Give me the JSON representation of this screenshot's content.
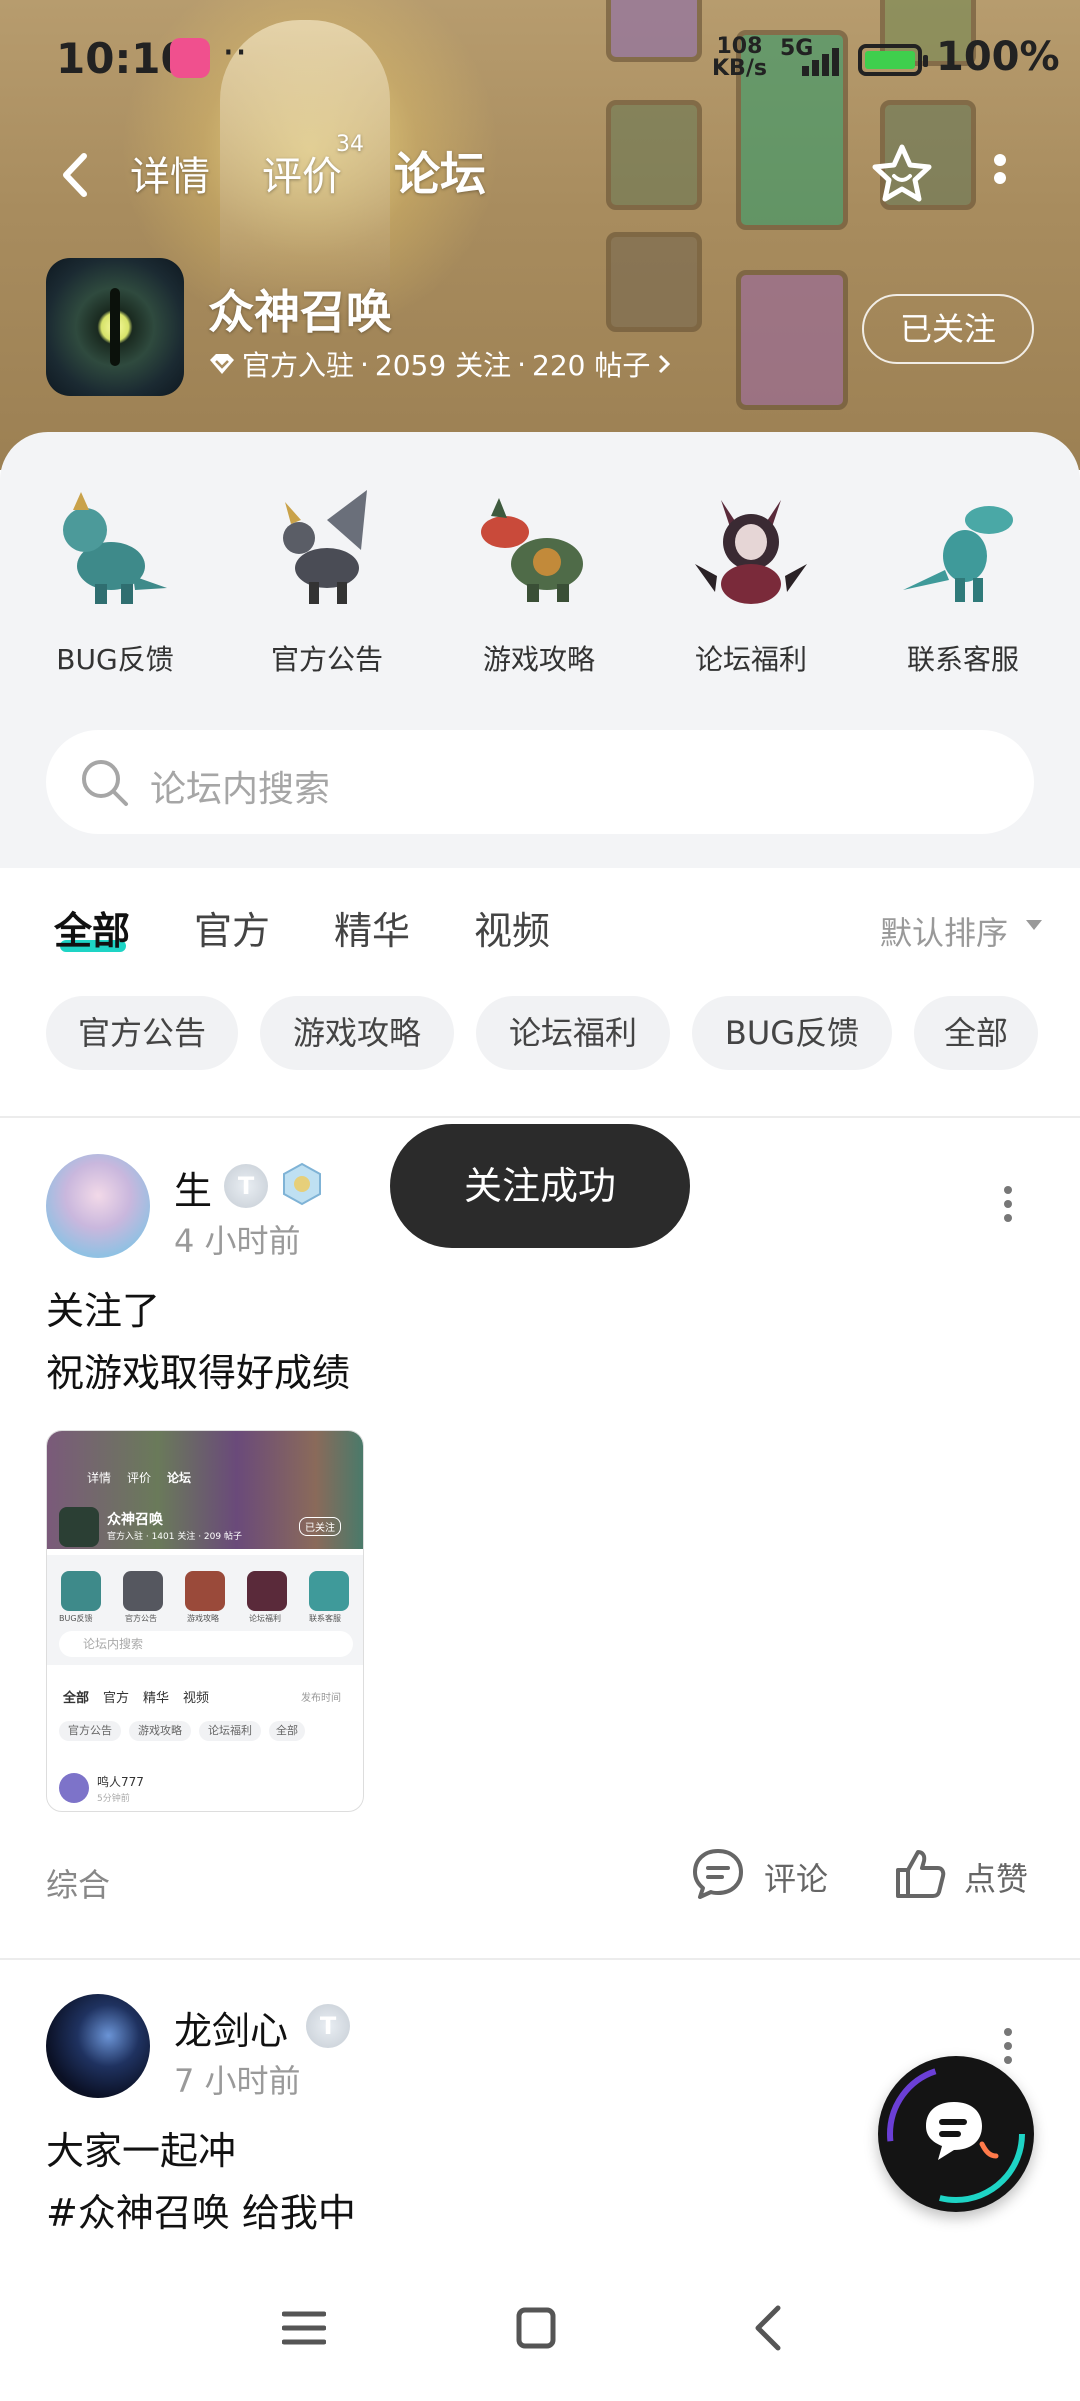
{
  "status_bar": {
    "time": "10:10",
    "network_speed": "108",
    "network_unit": "KB/s",
    "signal_type": "5G",
    "battery_level": "100%"
  },
  "top_nav": {
    "tabs": [
      {
        "label": "详情"
      },
      {
        "label": "评价",
        "count": "34"
      },
      {
        "label": "论坛"
      }
    ],
    "active_tab": "论坛"
  },
  "game": {
    "name": "众神召唤",
    "official": "官方入驻",
    "followers": "2059 关注",
    "posts": "220 帖子",
    "separator": "·",
    "follow_state": "已关注"
  },
  "categories": [
    {
      "label": "BUG反馈"
    },
    {
      "label": "官方公告"
    },
    {
      "label": "游戏攻略"
    },
    {
      "label": "论坛福利"
    },
    {
      "label": "联系客服"
    }
  ],
  "search": {
    "placeholder": "论坛内搜索"
  },
  "filter_tabs": [
    "全部",
    "官方",
    "精华",
    "视频"
  ],
  "sort_label": "默认排序",
  "chips": [
    "官方公告",
    "游戏攻略",
    "论坛福利",
    "BUG反馈",
    "全部"
  ],
  "posts": [
    {
      "username": "生",
      "time": "4 小时前",
      "lines": [
        "关注了",
        "祝游戏取得好成绩"
      ],
      "category": "综合",
      "comment_label": "评论",
      "like_label": "点赞",
      "thumbnail": {
        "tabs": [
          "详情",
          "评价",
          "论坛"
        ],
        "game_name": "众神召唤",
        "meta": "官方入驻 · 1401 关注 · 209 帖子",
        "follow_state": "已关注",
        "categories": [
          "BUG反馈",
          "官方公告",
          "游戏攻略",
          "论坛福利",
          "联系客服"
        ],
        "search": "论坛内搜索",
        "filter_tabs": [
          "全部",
          "官方",
          "精华",
          "视频"
        ],
        "sort": "发布时间",
        "chips": [
          "官方公告",
          "游戏攻略",
          "论坛福利",
          "全部"
        ],
        "user": "鸣人777",
        "user_time": "5分钟前"
      }
    },
    {
      "username": "龙剑心",
      "time": "7 小时前",
      "lines": [
        "大家一起冲",
        "#众神召唤 给我中"
      ]
    }
  ],
  "toast": "关注成功",
  "colors": {
    "accent": "#1ed4c5",
    "toast_bg": "#2b2b2b",
    "panel_bg": "#f3f4f6"
  }
}
